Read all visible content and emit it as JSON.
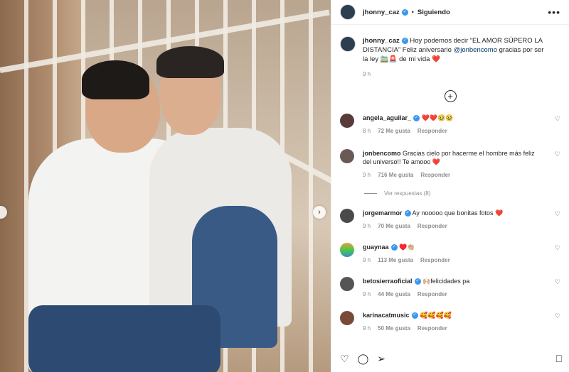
{
  "header": {
    "username": "jhonny_caz",
    "follow_status": "Siguiendo",
    "more": "•••"
  },
  "post": {
    "caption": {
      "username": "jhonny_caz",
      "text_before": "Hoy podemos decir “EL AMOR SÚPERO LA DISTANCIA” Feliz aniversario ",
      "mention": "@jonbencomo",
      "text_after": " gracias por ser la ley 🚞🚨 de mi vida",
      "heart": "❤️",
      "time": "9 h"
    }
  },
  "comments": [
    {
      "user": "angela_aguilar_",
      "text": "❤️❤️🥹🥹",
      "time": "8 h",
      "likes": "72 Me gusta",
      "reply": "Responder",
      "verified": true
    },
    {
      "user": "jonbencomo",
      "text": "Gracias cielo por hacerme el hombre más feliz del universo!! Te amooo ❤️",
      "time": "9 h",
      "likes": "716 Me gusta",
      "reply": "Responder",
      "verified": false
    },
    {
      "user": "jorgemarmor",
      "text": "Ay nooooo que bonitas fotos ❤️",
      "time": "9 h",
      "likes": "70 Me gusta",
      "reply": "Responder",
      "verified": true
    },
    {
      "user": "guaynaa",
      "text": "♥️👏🏼",
      "time": "9 h",
      "likes": "113 Me gusta",
      "reply": "Responder",
      "verified": true
    },
    {
      "user": "betosierraoficial",
      "text": "🙌🏼felicidades pa",
      "time": "9 h",
      "likes": "44 Me gusta",
      "reply": "Responder",
      "verified": true
    },
    {
      "user": "karinacatmusic",
      "text": "🥰🥰🥰🥰",
      "time": "9 h",
      "likes": "50 Me gusta",
      "reply": "Responder",
      "verified": true
    }
  ],
  "view_replies": "Ver respuestas (8)",
  "icons": {
    "heart": "heart-icon",
    "comment": "comment-icon",
    "share": "share-icon",
    "save": "bookmark-icon",
    "add_comment": "add-circle-icon",
    "next": "chevron-right-icon"
  },
  "colors": {
    "verified": "#3897f0",
    "mention": "#00376b",
    "meta": "#8e8e8e",
    "heart": "#ed4956"
  }
}
